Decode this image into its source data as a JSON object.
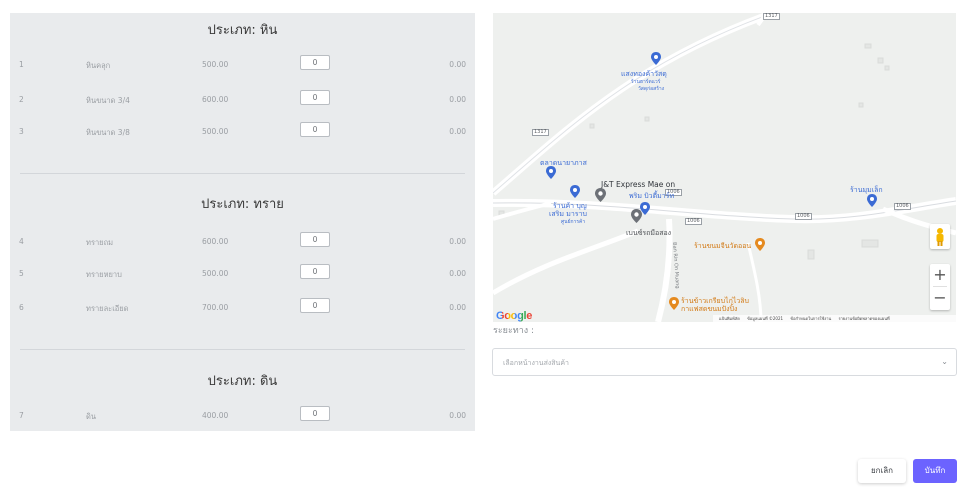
{
  "sections": [
    {
      "title": "ประเภท: หิน",
      "rows": [
        {
          "index": "1",
          "name": "หินคลุก",
          "price": "500.00",
          "qty": "0",
          "total": "0.00"
        },
        {
          "index": "2",
          "name": "หินขนาด 3/4",
          "price": "600.00",
          "qty": "0",
          "total": "0.00"
        },
        {
          "index": "3",
          "name": "หินขนาด 3/8",
          "price": "500.00",
          "qty": "0",
          "total": "0.00"
        }
      ]
    },
    {
      "title": "ประเภท: ทราย",
      "rows": [
        {
          "index": "4",
          "name": "ทรายถม",
          "price": "600.00",
          "qty": "0",
          "total": "0.00"
        },
        {
          "index": "5",
          "name": "ทรายหยาบ",
          "price": "500.00",
          "qty": "0",
          "total": "0.00"
        },
        {
          "index": "6",
          "name": "ทรายละเอียด",
          "price": "700.00",
          "qty": "0",
          "total": "0.00"
        }
      ]
    },
    {
      "title": "ประเภท: ดิน",
      "rows": [
        {
          "index": "7",
          "name": "ดิน",
          "price": "400.00",
          "qty": "0",
          "total": "0.00"
        }
      ]
    }
  ],
  "map": {
    "pois": {
      "p1": "แสงทองค้าวัสดุ",
      "p1b": "ร้านฮาร์ดแวร์",
      "p1c": "วัสดุก่อสร้าง",
      "p2": "ตลาดนายาภาส",
      "p3": "J&T Express Mae on",
      "p4": "ร้านค้า บุญ",
      "p4b": "เสริม มาราบ",
      "p4c": "ศูนย์การค้า",
      "p5": "พริม บิวตี้มาร์ท",
      "p6": "เบนซ์รถมือสอง",
      "p7": "ร้านขนมจีนวัดออน",
      "p8": "ร้านมุมเล็ก",
      "p9": "ร้านข้าวเกรียบไก่ไวลิบ",
      "p9b": "กาแฟสดขนมปังปิ้ง",
      "road_name": "Ban Rin On Muang",
      "road_tag_1": "1317",
      "road_tag_2": "1317",
      "road_tag_3": "1006",
      "road_tag_4": "1006",
      "road_tag_5": "1006",
      "road_tag_6": "1006"
    },
    "google_logo": "Google",
    "footer": {
      "shortcuts": "แป้นพิมพ์ลัด",
      "data": "ข้อมูลแผนที่ ©2021",
      "terms": "ข้อกำหนดในการใช้งาน",
      "report": "รายงานข้อผิดพลาดของแผนที่"
    },
    "zoom_in": "+",
    "zoom_out": "−"
  },
  "distance_label": "ระยะทาง :",
  "destination_select": {
    "placeholder": "เลือกหน้างานส่งสินค้า",
    "chevron": "⌄"
  },
  "buttons": {
    "cancel": "ยกเลิก",
    "save": "บันทึก"
  },
  "colors": {
    "panel_bg": "#e9ebed",
    "primary": "#6c63ff",
    "map_bg": "#eef0ee",
    "poi_blue": "#3b6bd4",
    "poi_orange": "#e58a1f",
    "pin_grey": "#6d7177"
  }
}
